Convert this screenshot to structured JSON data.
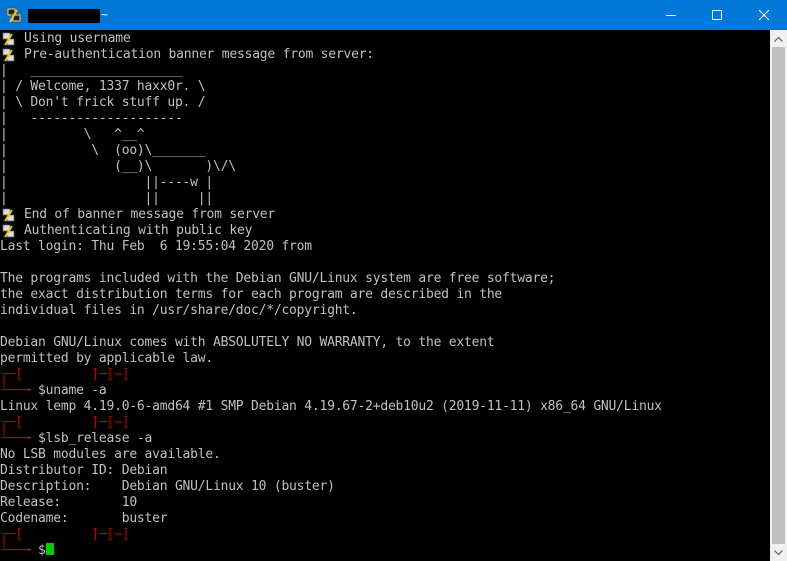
{
  "window": {
    "title_suffix": "~",
    "accent": "#0078d7"
  },
  "terminal": {
    "lines": [
      "Using username",
      "Pre-authentication banner message from server:",
      "|   ____________________",
      "| / Welcome, 1337 haxx0r. \\",
      "| \\ Don't frick stuff up. /",
      "|   --------------------",
      "|          \\   ^__^",
      "|           \\  (oo)\\_______",
      "|              (__)\\       )\\/\\",
      "|                  ||----w |",
      "|                  ||     ||",
      "End of banner message from server",
      "Authenticating with public key",
      "Last login: Thu Feb  6 19:55:04 2020 from",
      "",
      "The programs included with the Debian GNU/Linux system are free software;",
      "the exact distribution terms for each program are described in the",
      "individual files in /usr/share/doc/*/copyright.",
      "",
      "Debian GNU/Linux comes with ABSOLUTELY NO WARRANTY, to the extent",
      "permitted by applicable law."
    ],
    "prompt": {
      "top": "┌─[         ]─[~]",
      "arrow": "└──╼ ",
      "symbol": "$"
    },
    "cmd1": "uname -a",
    "out1": [
      "Linux lemp 4.19.0-6-amd64 #1 SMP Debian 4.19.67-2+deb10u2 (2019-11-11) x86_64 GNU/Linux"
    ],
    "cmd2": "lsb_release -a",
    "out2": [
      "No LSB modules are available.",
      "Distributor ID: Debian",
      "Description:    Debian GNU/Linux 10 (buster)",
      "Release:        10",
      "Codename:       buster"
    ],
    "colors": {
      "text": "#c0c0c0",
      "prompt": "#c00000",
      "cursor": "#00d000"
    }
  }
}
